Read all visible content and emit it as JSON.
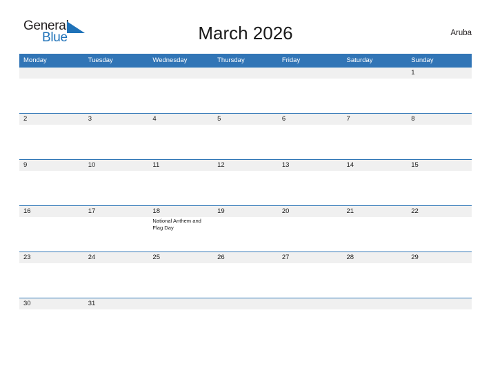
{
  "brand": {
    "name_part1": "General",
    "name_part2": "Blue",
    "triangle_color": "#1f72b8",
    "text_color": "#231f20",
    "blue_color": "#1f72b8"
  },
  "header": {
    "title": "March 2026",
    "region": "Aruba"
  },
  "theme": {
    "header_blue": "#3175b6",
    "row_border_blue": "#2e75b6",
    "band_gray": "#f0f0f0",
    "page_background": "#ffffff",
    "text_color": "#1a1a1a"
  },
  "calendar": {
    "month": "March",
    "year": "2026",
    "weekday_headers": [
      "Monday",
      "Tuesday",
      "Wednesday",
      "Thursday",
      "Friday",
      "Saturday",
      "Sunday"
    ],
    "weeks": [
      {
        "days": [
          {
            "num": "",
            "events": []
          },
          {
            "num": "",
            "events": []
          },
          {
            "num": "",
            "events": []
          },
          {
            "num": "",
            "events": []
          },
          {
            "num": "",
            "events": []
          },
          {
            "num": "",
            "events": []
          },
          {
            "num": "1",
            "events": []
          }
        ]
      },
      {
        "days": [
          {
            "num": "2",
            "events": []
          },
          {
            "num": "3",
            "events": []
          },
          {
            "num": "4",
            "events": []
          },
          {
            "num": "5",
            "events": []
          },
          {
            "num": "6",
            "events": []
          },
          {
            "num": "7",
            "events": []
          },
          {
            "num": "8",
            "events": []
          }
        ]
      },
      {
        "days": [
          {
            "num": "9",
            "events": []
          },
          {
            "num": "10",
            "events": []
          },
          {
            "num": "11",
            "events": []
          },
          {
            "num": "12",
            "events": []
          },
          {
            "num": "13",
            "events": []
          },
          {
            "num": "14",
            "events": []
          },
          {
            "num": "15",
            "events": []
          }
        ]
      },
      {
        "days": [
          {
            "num": "16",
            "events": []
          },
          {
            "num": "17",
            "events": []
          },
          {
            "num": "18",
            "events": [
              "National Anthem and Flag Day"
            ]
          },
          {
            "num": "19",
            "events": []
          },
          {
            "num": "20",
            "events": []
          },
          {
            "num": "21",
            "events": []
          },
          {
            "num": "22",
            "events": []
          }
        ]
      },
      {
        "days": [
          {
            "num": "23",
            "events": []
          },
          {
            "num": "24",
            "events": []
          },
          {
            "num": "25",
            "events": []
          },
          {
            "num": "26",
            "events": []
          },
          {
            "num": "27",
            "events": []
          },
          {
            "num": "28",
            "events": []
          },
          {
            "num": "29",
            "events": []
          }
        ]
      },
      {
        "days": [
          {
            "num": "30",
            "events": []
          },
          {
            "num": "31",
            "events": []
          },
          {
            "num": "",
            "events": []
          },
          {
            "num": "",
            "events": []
          },
          {
            "num": "",
            "events": []
          },
          {
            "num": "",
            "events": []
          },
          {
            "num": "",
            "events": []
          }
        ]
      }
    ]
  }
}
